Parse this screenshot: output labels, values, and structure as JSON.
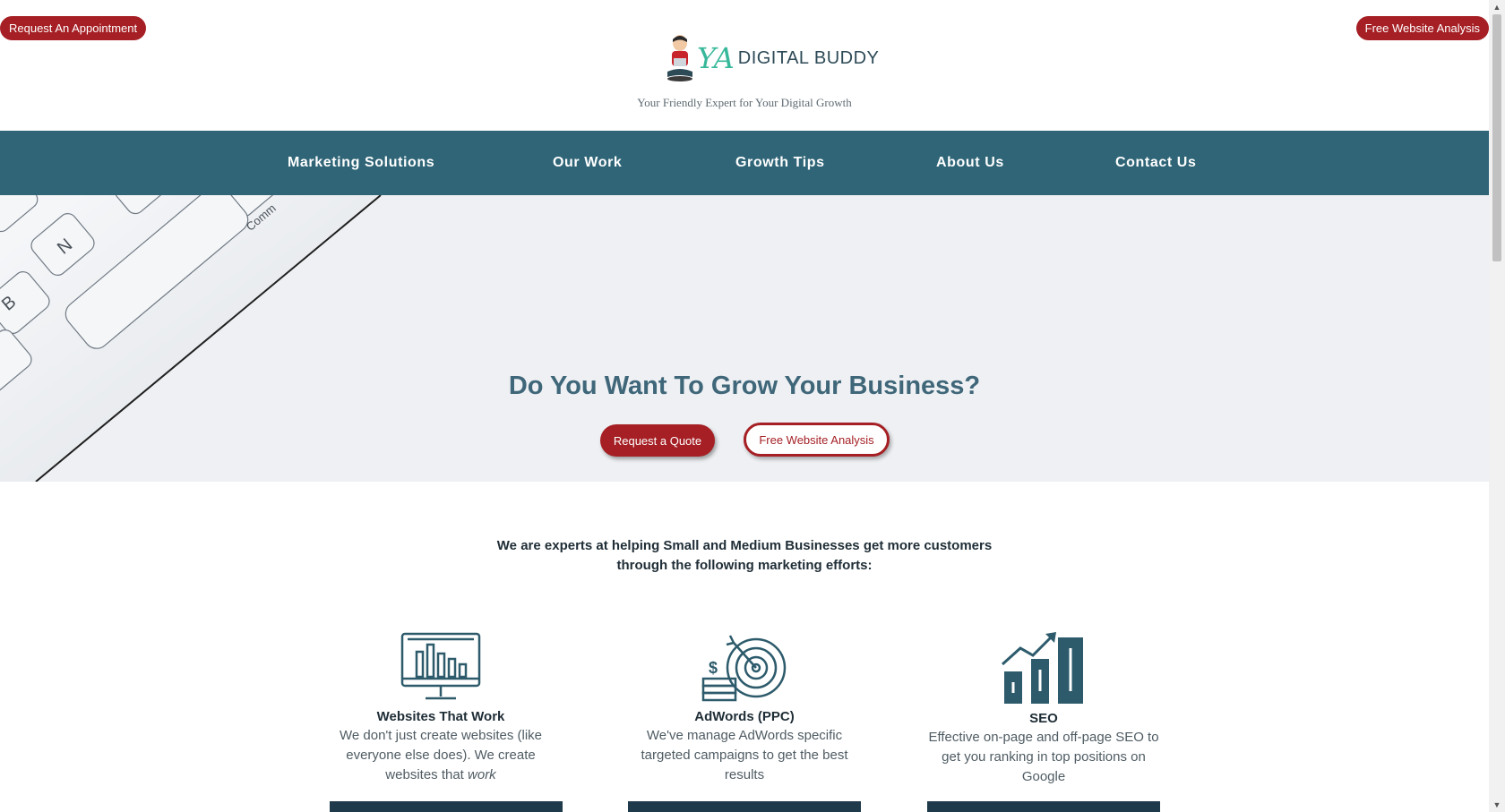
{
  "top_bar": {
    "appointment_label": "Request An Appointment",
    "analysis_label": "Free Website Analysis"
  },
  "logo": {
    "ya": "YA",
    "name": "DIGITAL BUDDY",
    "tagline": "Your Friendly Expert for Your Digital Growth"
  },
  "nav": {
    "items": [
      {
        "label": "Marketing Solutions"
      },
      {
        "label": "Our Work"
      },
      {
        "label": "Growth Tips"
      },
      {
        "label": "About Us"
      },
      {
        "label": "Contact Us"
      }
    ]
  },
  "hero": {
    "title": "Do You Want To Grow Your Business?",
    "quote_label": "Request a Quote",
    "analysis_label": "Free Website Analysis",
    "keys": [
      "N",
      "B",
      "Comm"
    ]
  },
  "intro": {
    "line1": "We are experts at helping Small and Medium Businesses get more customers",
    "line2": "through the following marketing efforts:"
  },
  "services": [
    {
      "icon": "monitor-chart-icon",
      "title": "Websites That Work",
      "desc_pre": "We don't just create websites (like everyone else does). We create websites that ",
      "desc_em": "work"
    },
    {
      "icon": "target-money-icon",
      "title": "AdWords (PPC)",
      "desc": "We've manage AdWords specific targeted campaigns to get the best results"
    },
    {
      "icon": "bar-chart-growth-icon",
      "title": "SEO",
      "desc": "Effective on-page and off-page SEO to get you ranking in top positions on Google"
    }
  ],
  "colors": {
    "brand_red": "#a51f24",
    "nav_teal": "#2f6577",
    "icon_teal": "#2d5b6b",
    "logo_green": "#38b89a"
  }
}
